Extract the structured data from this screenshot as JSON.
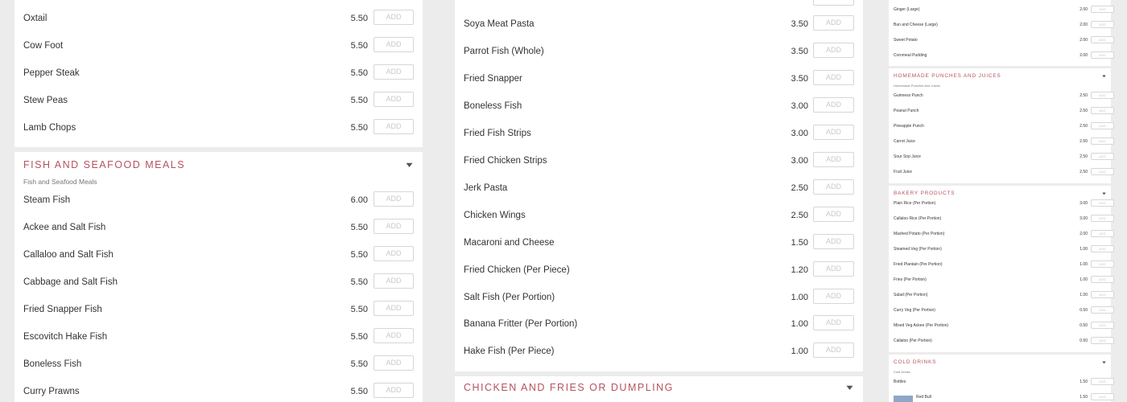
{
  "add_label": "ADD",
  "colors": {
    "accent": "#b5525e",
    "panel": "#ffffff",
    "background": "#ececec",
    "button_border": "#d6d6d6"
  },
  "col1": {
    "top_items": [
      {
        "name": "Oxtail",
        "price": "5.50"
      },
      {
        "name": "Cow Foot",
        "price": "5.50"
      },
      {
        "name": "Pepper Steak",
        "price": "5.50"
      },
      {
        "name": "Stew Peas",
        "price": "5.50"
      },
      {
        "name": "Lamb Chops",
        "price": "5.50"
      }
    ],
    "fish": {
      "title": "Fish and Seafood Meals",
      "subtitle": "Fish and Seafood Meals",
      "items": [
        {
          "name": "Steam Fish",
          "price": "6.00"
        },
        {
          "name": "Ackee and Salt Fish",
          "price": "5.50"
        },
        {
          "name": "Callaloo and Salt Fish",
          "price": "5.50"
        },
        {
          "name": "Cabbage and Salt Fish",
          "price": "5.50"
        },
        {
          "name": "Fried Snapper Fish",
          "price": "5.50"
        },
        {
          "name": "Escovitch Hake Fish",
          "price": "5.50"
        },
        {
          "name": "Boneless Fish",
          "price": "5.50"
        },
        {
          "name": "Curry Prawns",
          "price": "5.50"
        }
      ]
    }
  },
  "col2": {
    "items": [
      {
        "name": "Soya Meat Pasta",
        "price": "3.50"
      },
      {
        "name": "Parrot Fish (Whole)",
        "price": "3.50"
      },
      {
        "name": "Fried Snapper",
        "price": "3.50"
      },
      {
        "name": "Boneless Fish",
        "price": "3.00"
      },
      {
        "name": "Fried Fish Strips",
        "price": "3.00"
      },
      {
        "name": "Fried Chicken Strips",
        "price": "3.00"
      },
      {
        "name": "Jerk Pasta",
        "price": "2.50"
      },
      {
        "name": "Chicken Wings",
        "price": "2.50"
      },
      {
        "name": "Macaroni and Cheese",
        "price": "1.50"
      },
      {
        "name": "Fried Chicken (Per Piece)",
        "price": "1.20"
      },
      {
        "name": "Salt Fish (Per Portion)",
        "price": "1.00"
      },
      {
        "name": "Banana Fritter (Per Portion)",
        "price": "1.00"
      },
      {
        "name": "Hake Fish (Per Piece)",
        "price": "1.00"
      }
    ],
    "next_section_title": "Chicken and Fries or Dumpling"
  },
  "col3": {
    "top_items": [
      {
        "name": "Ginger (Large)",
        "price": "2.00"
      },
      {
        "name": "Bun and Cheese (Large)",
        "price": "2.00"
      },
      {
        "name": "Sweet Potato",
        "price": "2.00"
      },
      {
        "name": "Cornmeal Pudding",
        "price": "2.00"
      }
    ],
    "punches": {
      "title": "Homemade Punches and Juices",
      "subtitle": "Homemade Punches And Juices",
      "items": [
        {
          "name": "Guinness Punch",
          "price": "2.50"
        },
        {
          "name": "Peanut Punch",
          "price": "2.50"
        },
        {
          "name": "Pineapple Punch",
          "price": "2.50"
        },
        {
          "name": "Carrot Juice",
          "price": "2.50"
        },
        {
          "name": "Sour Sop Juice",
          "price": "2.50"
        },
        {
          "name": "Fruit Juice",
          "price": "2.50"
        }
      ]
    },
    "bakery": {
      "title": "Bakery Products",
      "items": [
        {
          "name": "Plain Rice (Per Portion)",
          "price": "3.00"
        },
        {
          "name": "Callaloo Rice (Per Portion)",
          "price": "3.00"
        },
        {
          "name": "Mashed Potato (Per Portion)",
          "price": "2.00"
        },
        {
          "name": "Steamed Veg (Per Portion)",
          "price": "1.00"
        },
        {
          "name": "Fried Plantain (Per Portion)",
          "price": "1.00"
        },
        {
          "name": "Fries (Per Portion)",
          "price": "1.00"
        },
        {
          "name": "Salad (Per Portion)",
          "price": "1.00"
        },
        {
          "name": "Curry Veg (Per Portion)",
          "price": "0.50"
        },
        {
          "name": "Mixed Veg Ackee (Per Portion)",
          "price": "0.50"
        },
        {
          "name": "Callaloo (Per Portion)",
          "price": "0.50"
        }
      ]
    },
    "cold": {
      "title": "Cold Drinks",
      "subtitle": "Cold Drinks",
      "items": [
        {
          "name": "Bottles",
          "price": "1.50"
        },
        {
          "name": "Red Bull",
          "price": "1.50"
        }
      ]
    }
  }
}
